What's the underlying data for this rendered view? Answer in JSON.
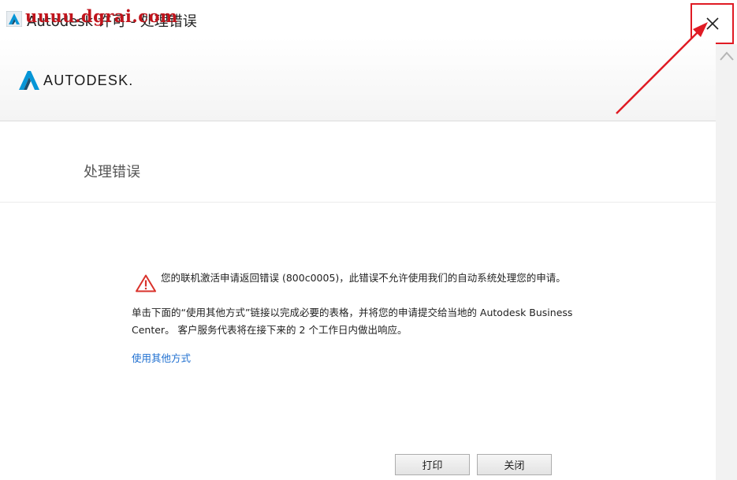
{
  "window": {
    "title": "Autodesk 许可 - 处理错误",
    "watermark": "uuuu.dgrai.com"
  },
  "header": {
    "brand": "AUTODESK."
  },
  "page": {
    "title": "处理错误"
  },
  "message": {
    "line1": "您的联机激活申请返回错误 (800c0005)，此错误不允许使用我们的自动系统处理您的申请。",
    "line2": "单击下面的“使用其他方式”链接以完成必要的表格，并将您的申请提交给当地的 Autodesk Business Center。 客户服务代表将在接下来的 2 个工作日内做出响应。",
    "link": "使用其他方式"
  },
  "buttons": {
    "print": "打印",
    "close": "关闭"
  },
  "colors": {
    "annotation_red": "#e01b24",
    "link_blue": "#1e6fd0"
  }
}
